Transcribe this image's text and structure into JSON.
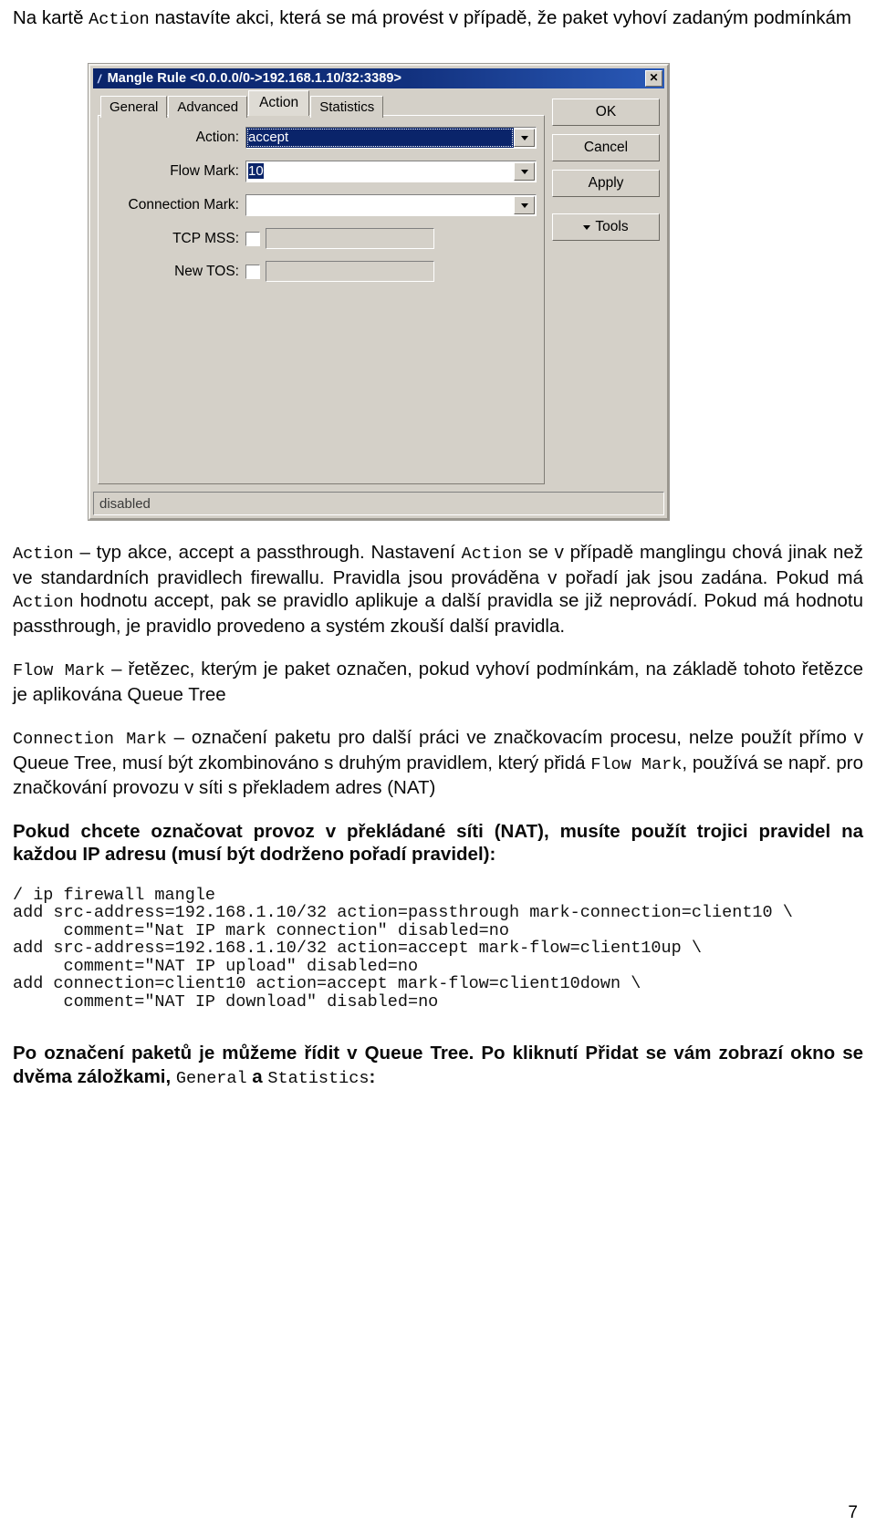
{
  "intro": {
    "text_before": "Na kartě ",
    "code_action": "Action",
    "text_after": " nastavíte akci, která se má provést v případě, že paket vyhoví zadaným podmínkám"
  },
  "dialog": {
    "title": "Mangle Rule <0.0.0.0/0->192.168.1.10/32:3389>",
    "title_icon": "pencil-icon",
    "close_label": "✕",
    "tabs": [
      {
        "label": "General",
        "active": false
      },
      {
        "label": "Advanced",
        "active": false
      },
      {
        "label": "Action",
        "active": true
      },
      {
        "label": "Statistics",
        "active": false
      }
    ],
    "fields": {
      "action": {
        "label": "Action:",
        "value": "accept"
      },
      "flow_mark": {
        "label": "Flow Mark:",
        "value": "10"
      },
      "connection_mark": {
        "label": "Connection Mark:",
        "value": ""
      },
      "tcp_mss": {
        "label": "TCP MSS:",
        "value": "",
        "checked": false
      },
      "new_tos": {
        "label": "New TOS:",
        "value": "",
        "checked": false
      }
    },
    "buttons": {
      "ok": "OK",
      "cancel": "Cancel",
      "apply": "Apply",
      "tools": "Tools"
    },
    "status": "disabled"
  },
  "body": {
    "p_action": {
      "c1": "Action",
      "t1": " – typ akce, accept a passthrough. Nastavení ",
      "c2": "Action",
      "t2": " se v případě manglingu chová jinak než ve standardních pravidlech firewallu. Pravidla jsou prováděna v pořadí jak jsou zadána. Pokud má ",
      "c3": "Action",
      "t3": " hodnotu accept, pak se pravidlo aplikuje a další pravidla se již neprovádí. Pokud má hodnotu passthrough, je pravidlo provedeno a systém zkouší další pravidla."
    },
    "p_flow": {
      "c1": "Flow Mark",
      "t1": " – řetězec, kterým je paket označen, pokud vyhoví podmínkám, na základě tohoto řetězce je aplikována Queue Tree"
    },
    "p_conn": {
      "c1": "Connection Mark",
      "t1": " – označení paketu pro další práci ve značkovacím procesu, nelze použít přímo v Queue Tree, musí být zkombinováno s druhým pravidlem, který přidá ",
      "c2": "Flow Mark",
      "t2": ", používá se např. pro značkování provozu v síti s překladem adres (NAT)"
    },
    "p_nat": "Pokud chcete označovat provoz v překládané síti (NAT), musíte použít trojici pravidel na každou IP adresu (musí být dodrženo pořadí pravidel):",
    "code": "/ ip firewall mangle\nadd src-address=192.168.1.10/32 action=passthrough mark-connection=client10 \\\n     comment=\"Nat IP mark connection\" disabled=no\nadd src-address=192.168.1.10/32 action=accept mark-flow=client10up \\\n     comment=\"NAT IP upload\" disabled=no\nadd connection=client10 action=accept mark-flow=client10down \\\n     comment=\"NAT IP download\" disabled=no",
    "p_final": {
      "t1": "Po označení paketů je můžeme řídit v Queue Tree. Po kliknutí Přidat se vám zobrazí okno se dvěma záložkami, ",
      "c1": "General",
      "t2": " a ",
      "c2": "Statistics",
      "t3": ":"
    }
  },
  "page_number": "7"
}
